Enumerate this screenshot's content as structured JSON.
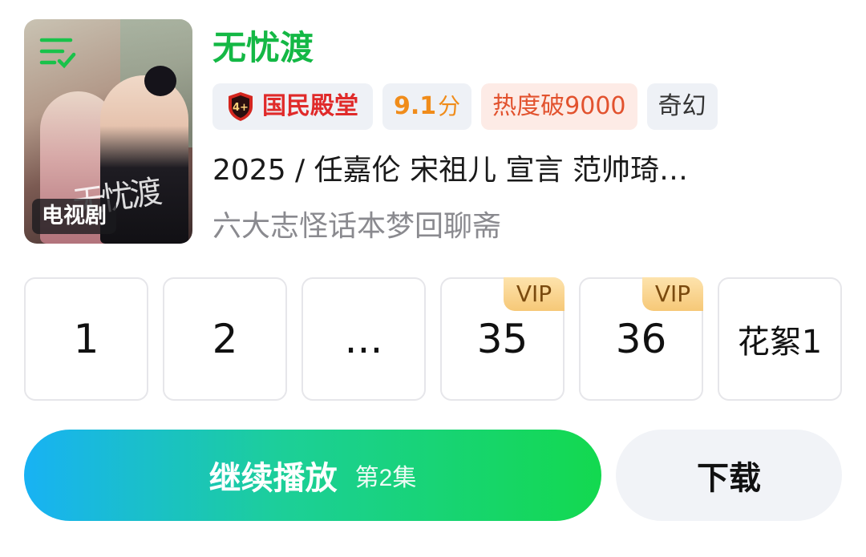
{
  "poster": {
    "type_badge": "电视剧",
    "icon": "list-check-icon",
    "title_art": "无忧渡"
  },
  "show": {
    "title": "无忧渡",
    "title_color": "#14b845"
  },
  "tags": {
    "award": "国民殿堂",
    "award_icon": "rank-shield-icon",
    "score": "9.1",
    "score_unit": "分",
    "heat": "热度破9000",
    "genre": "奇幻"
  },
  "meta": "2025 / 任嘉伦  宋祖儿  宣言  范帅琦…",
  "slogan": "六大志怪话本梦回聊斋",
  "episodes": [
    {
      "label": "1"
    },
    {
      "label": "2"
    },
    {
      "label": "..."
    },
    {
      "label": "35",
      "badge": "VIP"
    },
    {
      "label": "36",
      "badge": "VIP"
    },
    {
      "label": "花絮1"
    }
  ],
  "actions": {
    "play_label": "继续播放",
    "play_sub": "第2集",
    "download_label": "下载"
  }
}
